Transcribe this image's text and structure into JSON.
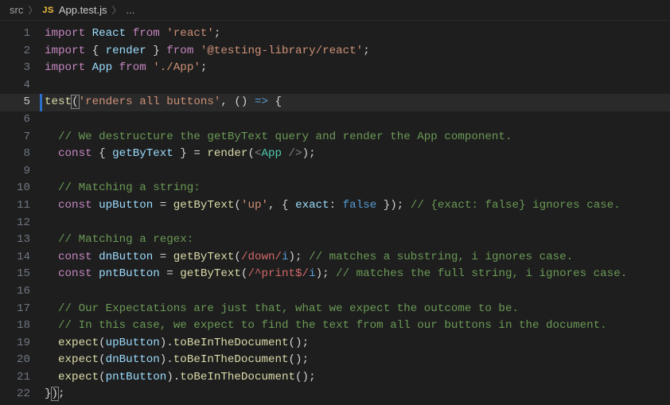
{
  "breadcrumb": {
    "root": "src",
    "badge": "JS",
    "file": "App.test.js",
    "trail": "..."
  },
  "activeLine": 5,
  "lines": [
    {
      "n": 1,
      "tokens": [
        [
          "kw",
          "import"
        ],
        [
          "pn",
          " "
        ],
        [
          "id",
          "React"
        ],
        [
          "pn",
          " "
        ],
        [
          "kw",
          "from"
        ],
        [
          "pn",
          " "
        ],
        [
          "str",
          "'react'"
        ],
        [
          "pn",
          ";"
        ]
      ]
    },
    {
      "n": 2,
      "tokens": [
        [
          "kw",
          "import"
        ],
        [
          "pn",
          " { "
        ],
        [
          "id",
          "render"
        ],
        [
          "pn",
          " } "
        ],
        [
          "kw",
          "from"
        ],
        [
          "pn",
          " "
        ],
        [
          "str",
          "'@testing-library/react'"
        ],
        [
          "pn",
          ";"
        ]
      ]
    },
    {
      "n": 3,
      "tokens": [
        [
          "kw",
          "import"
        ],
        [
          "pn",
          " "
        ],
        [
          "id",
          "App"
        ],
        [
          "pn",
          " "
        ],
        [
          "kw",
          "from"
        ],
        [
          "pn",
          " "
        ],
        [
          "str",
          "'./App'"
        ],
        [
          "pn",
          ";"
        ]
      ]
    },
    {
      "n": 4,
      "tokens": []
    },
    {
      "n": 5,
      "tokens": [
        [
          "fn",
          "test"
        ],
        [
          "pn brace-hi",
          "("
        ],
        [
          "str",
          "'renders all buttons'"
        ],
        [
          "pn",
          ", "
        ],
        [
          "pn",
          "("
        ],
        [
          "pn",
          ")"
        ],
        [
          "pn",
          " "
        ],
        [
          "arrow",
          "=>"
        ],
        [
          "pn",
          " {"
        ]
      ]
    },
    {
      "n": 6,
      "tokens": []
    },
    {
      "n": 7,
      "tokens": [
        [
          "pn",
          "  "
        ],
        [
          "cm",
          "// We destructure the getByText query and render the App component."
        ]
      ]
    },
    {
      "n": 8,
      "tokens": [
        [
          "pn",
          "  "
        ],
        [
          "kw",
          "const"
        ],
        [
          "pn",
          " { "
        ],
        [
          "id",
          "getByText"
        ],
        [
          "pn",
          " } = "
        ],
        [
          "fn",
          "render"
        ],
        [
          "pn",
          "("
        ],
        [
          "tagp",
          "<"
        ],
        [
          "tag",
          "App"
        ],
        [
          "pn",
          " "
        ],
        [
          "tagp",
          "/>"
        ],
        [
          "pn",
          ")"
        ],
        [
          "pn",
          ";"
        ]
      ]
    },
    {
      "n": 9,
      "tokens": []
    },
    {
      "n": 10,
      "tokens": [
        [
          "pn",
          "  "
        ],
        [
          "cm",
          "// Matching a string:"
        ]
      ]
    },
    {
      "n": 11,
      "tokens": [
        [
          "pn",
          "  "
        ],
        [
          "kw",
          "const"
        ],
        [
          "pn",
          " "
        ],
        [
          "id",
          "upButton"
        ],
        [
          "pn",
          " = "
        ],
        [
          "fn",
          "getByText"
        ],
        [
          "pn",
          "("
        ],
        [
          "str",
          "'up'"
        ],
        [
          "pn",
          ", { "
        ],
        [
          "id",
          "exact"
        ],
        [
          "pn",
          ": "
        ],
        [
          "bool",
          "false"
        ],
        [
          "pn",
          " }); "
        ],
        [
          "cm",
          "// {exact: false} ignores case."
        ]
      ]
    },
    {
      "n": 12,
      "tokens": []
    },
    {
      "n": 13,
      "tokens": [
        [
          "pn",
          "  "
        ],
        [
          "cm",
          "// Matching a regex:"
        ]
      ]
    },
    {
      "n": 14,
      "tokens": [
        [
          "pn",
          "  "
        ],
        [
          "kw",
          "const"
        ],
        [
          "pn",
          " "
        ],
        [
          "id",
          "dnButton"
        ],
        [
          "pn",
          " = "
        ],
        [
          "fn",
          "getByText"
        ],
        [
          "pn",
          "("
        ],
        [
          "rx",
          "/down/"
        ],
        [
          "rxf",
          "i"
        ],
        [
          "pn",
          "); "
        ],
        [
          "cm",
          "// matches a substring, i ignores case."
        ]
      ]
    },
    {
      "n": 15,
      "tokens": [
        [
          "pn",
          "  "
        ],
        [
          "kw",
          "const"
        ],
        [
          "pn",
          " "
        ],
        [
          "id",
          "pntButton"
        ],
        [
          "pn",
          " = "
        ],
        [
          "fn",
          "getByText"
        ],
        [
          "pn",
          "("
        ],
        [
          "rx",
          "/^print$/"
        ],
        [
          "rxf",
          "i"
        ],
        [
          "pn",
          "); "
        ],
        [
          "cm",
          "// matches the full string, i ignores case."
        ]
      ]
    },
    {
      "n": 16,
      "tokens": []
    },
    {
      "n": 17,
      "tokens": [
        [
          "pn",
          "  "
        ],
        [
          "cm",
          "// Our Expectations are just that, what we expect the outcome to be."
        ]
      ]
    },
    {
      "n": 18,
      "tokens": [
        [
          "pn",
          "  "
        ],
        [
          "cm",
          "// In this case, we expect to find the text from all our buttons in the document."
        ]
      ]
    },
    {
      "n": 19,
      "tokens": [
        [
          "pn",
          "  "
        ],
        [
          "fn",
          "expect"
        ],
        [
          "pn",
          "("
        ],
        [
          "id",
          "upButton"
        ],
        [
          "pn",
          ")."
        ],
        [
          "fn",
          "toBeInTheDocument"
        ],
        [
          "pn",
          "();"
        ]
      ]
    },
    {
      "n": 20,
      "tokens": [
        [
          "pn",
          "  "
        ],
        [
          "fn",
          "expect"
        ],
        [
          "pn",
          "("
        ],
        [
          "id",
          "dnButton"
        ],
        [
          "pn",
          ")."
        ],
        [
          "fn",
          "toBeInTheDocument"
        ],
        [
          "pn",
          "();"
        ]
      ]
    },
    {
      "n": 21,
      "tokens": [
        [
          "pn",
          "  "
        ],
        [
          "fn",
          "expect"
        ],
        [
          "pn",
          "("
        ],
        [
          "id",
          "pntButton"
        ],
        [
          "pn",
          ")."
        ],
        [
          "fn",
          "toBeInTheDocument"
        ],
        [
          "pn",
          "();"
        ]
      ]
    },
    {
      "n": 22,
      "tokens": [
        [
          "pn",
          "}"
        ],
        [
          "pn brace-hi",
          ")"
        ],
        [
          "pn",
          ";"
        ]
      ]
    }
  ]
}
